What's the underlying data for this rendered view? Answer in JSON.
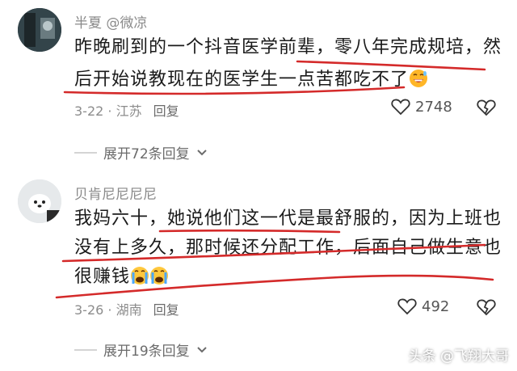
{
  "comments": [
    {
      "username": "半夏 @微凉",
      "lines": [
        "昨晚刷到的一个抖音医学前辈，零八年完成规培，然",
        "后开始说教现在的医学生一点苦都吃不了"
      ],
      "date_location": "3-22 · 江苏",
      "reply_label": "回复",
      "likes": "2748",
      "expand_label": "展开72条回复",
      "emoji": "grinning-sweat-emoji"
    },
    {
      "username": "贝肯尼尼尼尼",
      "lines": [
        "我妈六十，她说他们这一代是最舒服的，因为上班也",
        "没有上多久，那时候还分配工作，后面自己做生意也",
        "很赚钱"
      ],
      "date_location": "3-26 · 湖南",
      "reply_label": "回复",
      "likes": "492",
      "expand_label": "展开19条回复",
      "emoji": "crying-emoji"
    }
  ],
  "watermark": "头条 @飞翔大哥",
  "colors": {
    "underline": "#d42a2a",
    "text": "#1a1a1a",
    "muted": "#8c8c8c"
  }
}
